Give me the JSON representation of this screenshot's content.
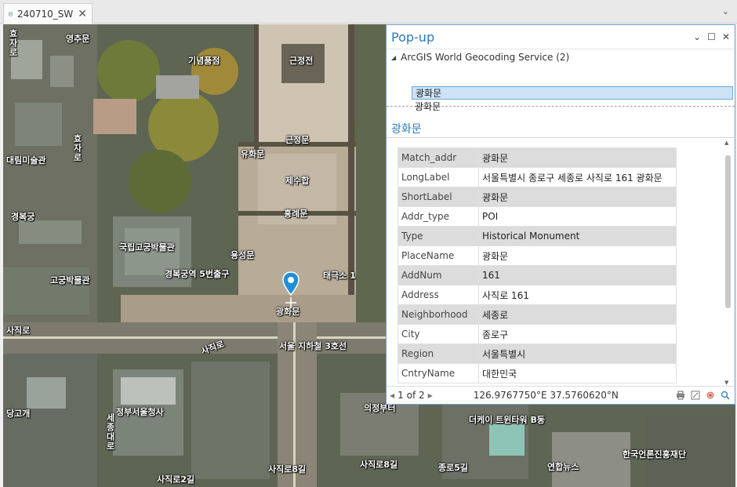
{
  "tab": {
    "label": "240710_SW"
  },
  "map_labels": {
    "hyoja_top": "효자로",
    "hyoja": "효자로",
    "yeongchumun": "영추문",
    "ginyeom": "기념품점",
    "geunjeongjeon": "근정전",
    "geunjeongmun": "근정문",
    "yuhwamun": "유화문",
    "gallery": "대림미술관",
    "heungnyemun": "흥례문",
    "sojun": "제수합",
    "national": "국립고궁박물관",
    "gyeongbok5": "경복궁역 5번출구",
    "gogung": "고궁박물관",
    "yongseongmun": "용성문",
    "gwanghwamun_map": "광화문",
    "sajikro": "사직로",
    "line3": "서울 지하철 3호선",
    "sejong": "세종대로",
    "uijeongbu": "의정부터",
    "sajikro8": "사직로8길",
    "sajikro8b": "사직로8길",
    "jongno5": "종로5길",
    "sajikro2": "사직로2길",
    "yonhap": "연합뉴스",
    "jeongbu": "정부서울청사",
    "twintree": "더케이 트윈타워 B동",
    "korea_press": "한국언론진흥재단",
    "dangol": "당고개",
    "tae1": "태극소 1",
    "gyeongbokgung": "경복궁",
    "sajik_street": "사직로"
  },
  "popup": {
    "title": "Pop-up",
    "tree": {
      "root": "ArcGIS World Geocoding Service (2)",
      "items": [
        "광화문",
        "광화문"
      ]
    },
    "detail_title": "광화문",
    "rows": [
      {
        "key": "Match_addr",
        "value": "광화문"
      },
      {
        "key": "LongLabel",
        "value": "서울특별시 종로구 세종로 사직로 161 광화문"
      },
      {
        "key": "ShortLabel",
        "value": "광화문"
      },
      {
        "key": "Addr_type",
        "value": "POI"
      },
      {
        "key": "Type",
        "value": "Historical Monument"
      },
      {
        "key": "PlaceName",
        "value": "광화문"
      },
      {
        "key": "AddNum",
        "value": "161"
      },
      {
        "key": "Address",
        "value": "사직로 161"
      },
      {
        "key": "Neighborhood",
        "value": "세종로"
      },
      {
        "key": "City",
        "value": "종로구"
      },
      {
        "key": "Region",
        "value": "서울특별시"
      },
      {
        "key": "CntryName",
        "value": "대한민국"
      }
    ],
    "pager": "1 of 2",
    "coords": "126.9767750°E 37.5760620°N"
  }
}
